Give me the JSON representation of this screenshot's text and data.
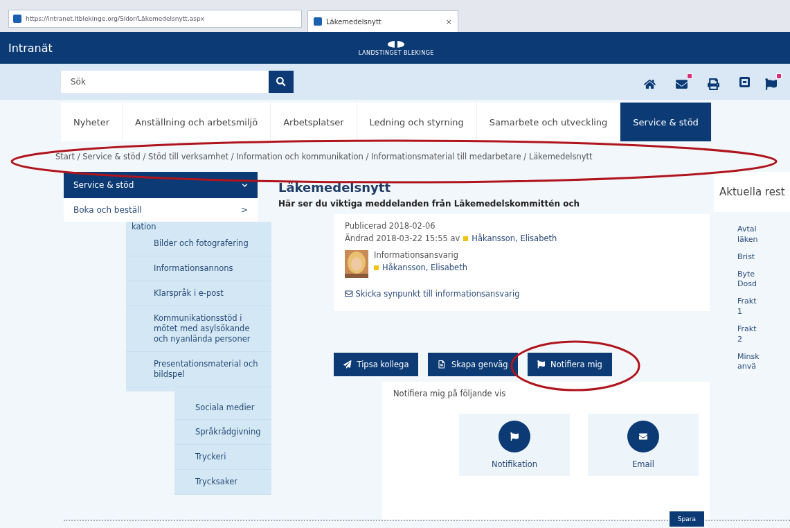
{
  "browser": {
    "address": "https://intranet.ltblekinge.org/Sidor/Läkemedelsnytt.aspx",
    "tab_title": "Läkemedelsnytt",
    "tab_close": "×"
  },
  "header": {
    "title": "Intranät",
    "logo_text": "LANDSTINGET BLEKINGE"
  },
  "search": {
    "placeholder": "Sök"
  },
  "nav_tabs": [
    {
      "label": "Nyheter",
      "selected": false
    },
    {
      "label": "Anställning och arbetsmiljö",
      "selected": false
    },
    {
      "label": "Arbetsplatser",
      "selected": false
    },
    {
      "label": "Ledning och styrning",
      "selected": false
    },
    {
      "label": "Samarbete och utveckling",
      "selected": false
    },
    {
      "label": "Service & stöd",
      "selected": true
    }
  ],
  "breadcrumb": "Start / Service & stöd / Stöd till verksamhet / Information och kommunikation / Informationsmaterial till medarbetare / Läkemedelsnytt",
  "sidebar": {
    "title": "Service & stöd",
    "expanded": true,
    "items": [
      {
        "label": "Boka och beställ",
        "arrow": ">"
      }
    ]
  },
  "submenu": {
    "heading": "kation",
    "items": [
      "Bilder och fotografering",
      "Informationsannons",
      "Klarspråk i e-post",
      "Kommunikationsstöd i mötet med asylsökande och nyanlända personer",
      "Presentationsmaterial och bildspel"
    ]
  },
  "submenu_2": {
    "items": [
      "Sociala medier",
      "Språkrådgivning",
      "Tryckeri",
      "Trycksaker"
    ]
  },
  "article": {
    "title": "Läkemedelsnytt",
    "lead": "Här ser du viktiga meddelanden från Läkemedelskommittén och",
    "published": "Publicerad 2018-02-06",
    "changed": "Ändrad 2018-03-22 15:55 av",
    "changed_by": "Håkansson, Elisabeth",
    "contact_role": "Informationsansvarig",
    "contact_name": "Håkansson, Elisabeth",
    "feedback_link": "Skicka synpunkt till informationsansvarig"
  },
  "actions": [
    {
      "label": "Tipsa kollega",
      "kind": "send"
    },
    {
      "label": "Skapa genväg",
      "kind": "shortcut"
    },
    {
      "label": "Notifiera mig",
      "kind": "flag"
    }
  ],
  "notify": {
    "heading": "Notifiera mig på följande vis",
    "options": [
      {
        "label": "Notifikation",
        "kind": "flag"
      },
      {
        "label": "Email",
        "kind": "mail"
      }
    ],
    "save": "Spara"
  },
  "right_panel": {
    "title": "Aktuella rest",
    "items": [
      "Avtal\nläken",
      "Brist",
      "Byte\nDosd",
      "Frakt\n1",
      "Frakt\n2",
      "Minsk\nanvä"
    ]
  }
}
